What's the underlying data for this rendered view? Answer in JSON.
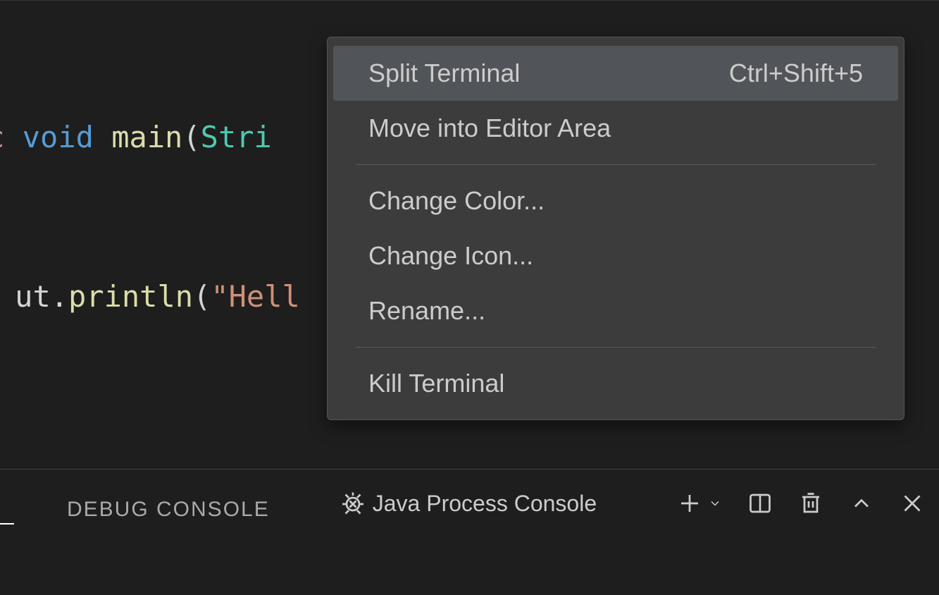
{
  "editor": {
    "top_fragment": "{",
    "line1": {
      "modifier_fragment": "c",
      "keyword_void": "void",
      "method": "main",
      "paren_open": "(",
      "type": "Stri"
    },
    "line2": {
      "object_fragment": "ut",
      "dot": ".",
      "method": "println",
      "paren_open": "(",
      "string": "\"Hell"
    }
  },
  "context_menu": {
    "items": [
      {
        "label": "Split Terminal",
        "shortcut": "Ctrl+Shift+5",
        "highlighted": true
      },
      {
        "label": "Move into Editor Area",
        "shortcut": ""
      }
    ],
    "items2": [
      {
        "label": "Change Color...",
        "shortcut": ""
      },
      {
        "label": "Change Icon...",
        "shortcut": ""
      },
      {
        "label": "Rename...",
        "shortcut": ""
      }
    ],
    "items3": [
      {
        "label": "Kill Terminal",
        "shortcut": ""
      }
    ]
  },
  "bottom_panel": {
    "debug_console": "DEBUG CONSOLE",
    "terminal_name": "Java Process Console"
  }
}
